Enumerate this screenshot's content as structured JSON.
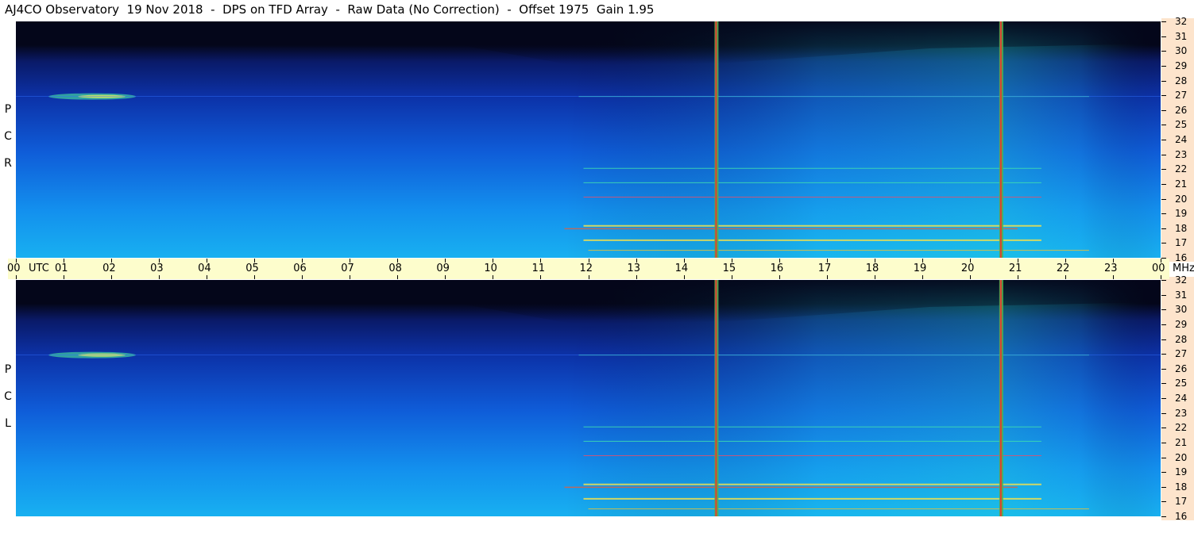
{
  "header": {
    "title": "AJ4CO Observatory  19 Nov 2018  -  DPS on TFD Array  -  Raw Data (No Correction)  -  Offset 1975  Gain 1.95"
  },
  "panels": {
    "top": {
      "label_letters": [
        "R",
        "C",
        "P"
      ]
    },
    "bottom": {
      "label_letters": [
        "L",
        "C",
        "P"
      ]
    }
  },
  "time_axis": {
    "labels": [
      "00",
      "01",
      "02",
      "03",
      "04",
      "05",
      "06",
      "07",
      "08",
      "09",
      "10",
      "11",
      "12",
      "13",
      "14",
      "15",
      "16",
      "17",
      "18",
      "19",
      "20",
      "21",
      "22",
      "23",
      "00"
    ],
    "utc_label": "UTC",
    "unit_label": "MHz"
  },
  "freq_axis": {
    "labels": [
      "32",
      "31",
      "30",
      "29",
      "28",
      "27",
      "26",
      "25",
      "24",
      "23",
      "22",
      "21",
      "20",
      "19",
      "18",
      "17",
      "16"
    ]
  },
  "colors": {
    "background": "#05071c",
    "low": "#0a1a70",
    "mid": "#1060e8",
    "high": "#18b8f0",
    "hot": "#f0f060",
    "red": "#e03028"
  },
  "chart_data": {
    "type": "heatmap",
    "title": "AJ4CO Observatory  19 Nov 2018  -  DPS on TFD Array  -  Raw Data (No Correction)  -  Offset 1975  Gain 1.95",
    "xlabel": "UTC",
    "ylabel": "MHz",
    "x_range_utc_hours": [
      0,
      24
    ],
    "y_range_mhz": [
      16,
      32
    ],
    "panels": [
      "RCP",
      "LCP"
    ],
    "vertical_interference_lines_utc": [
      14.68,
      20.65
    ],
    "notable_horizontal_signals_mhz": [
      27,
      22,
      21,
      20,
      18,
      17
    ]
  }
}
